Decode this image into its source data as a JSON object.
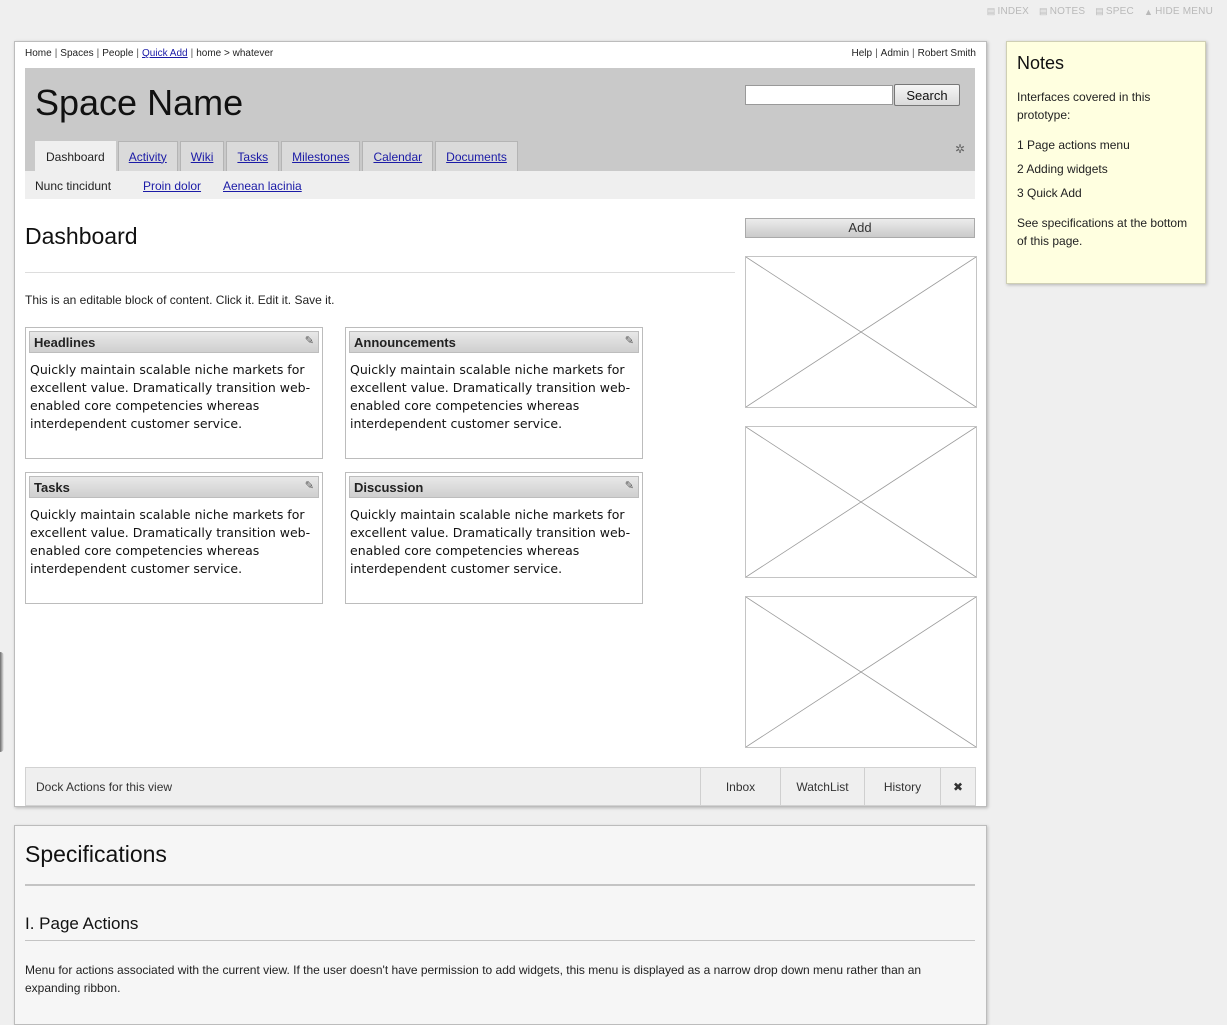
{
  "proto_menu": {
    "items": [
      {
        "icon": "index-icon",
        "label": "INDEX"
      },
      {
        "icon": "notes-icon",
        "label": "NOTES"
      },
      {
        "icon": "spec-icon",
        "label": "SPEC"
      },
      {
        "icon": "hide-icon",
        "label": "HIDE MENU"
      }
    ]
  },
  "util": {
    "home": "Home",
    "spaces": "Spaces",
    "people": "People",
    "quick_add": "Quick Add",
    "breadcrumb": "home > whatever",
    "help": "Help",
    "admin": "Admin",
    "user": "Robert Smith"
  },
  "header": {
    "space_name": "Space Name",
    "search_placeholder": "",
    "search_label": "Search"
  },
  "tabs": [
    "Dashboard",
    "Activity",
    "Wiki",
    "Tasks",
    "Milestones",
    "Calendar",
    "Documents"
  ],
  "subnav": {
    "current": "Nunc tincidunt",
    "link1": "Proin dolor",
    "link2": "Aenean lacinia"
  },
  "page": {
    "title": "Dashboard",
    "editable": "This is an editable block of content. Click it. Edit it. Save it.",
    "add_label": "Add"
  },
  "widgets": [
    {
      "title": "Headlines",
      "body": "Quickly maintain scalable niche markets for excellent value. Dramatically transition web-enabled core competencies whereas interdependent customer service."
    },
    {
      "title": "Announcements",
      "body": "Quickly maintain scalable niche markets for excellent value. Dramatically transition web-enabled core competencies whereas interdependent customer service."
    },
    {
      "title": "Tasks",
      "body": "Quickly maintain scalable niche markets for excellent value. Dramatically transition web-enabled core competencies whereas interdependent customer service."
    },
    {
      "title": "Discussion",
      "body": "Quickly maintain scalable niche markets for excellent value. Dramatically transition web-enabled core competencies whereas interdependent customer service."
    }
  ],
  "dock": {
    "label": "Dock Actions for this view",
    "inbox": "Inbox",
    "watchlist": "WatchList",
    "history": "History",
    "close": "✖"
  },
  "notes": {
    "title": "Notes",
    "intro": "Interfaces covered in this prototype:",
    "items": [
      "1 Page actions menu",
      "2 Adding widgets",
      "3 Quick Add"
    ],
    "footer": "See specifications at the bottom of this page."
  },
  "specs": {
    "title": "Specifications",
    "section": "I. Page Actions",
    "text": "Menu for actions associated with the current view. If the user doesn't have permission to add widgets, this menu is displayed as a narrow drop down menu rather than an expanding ribbon."
  }
}
